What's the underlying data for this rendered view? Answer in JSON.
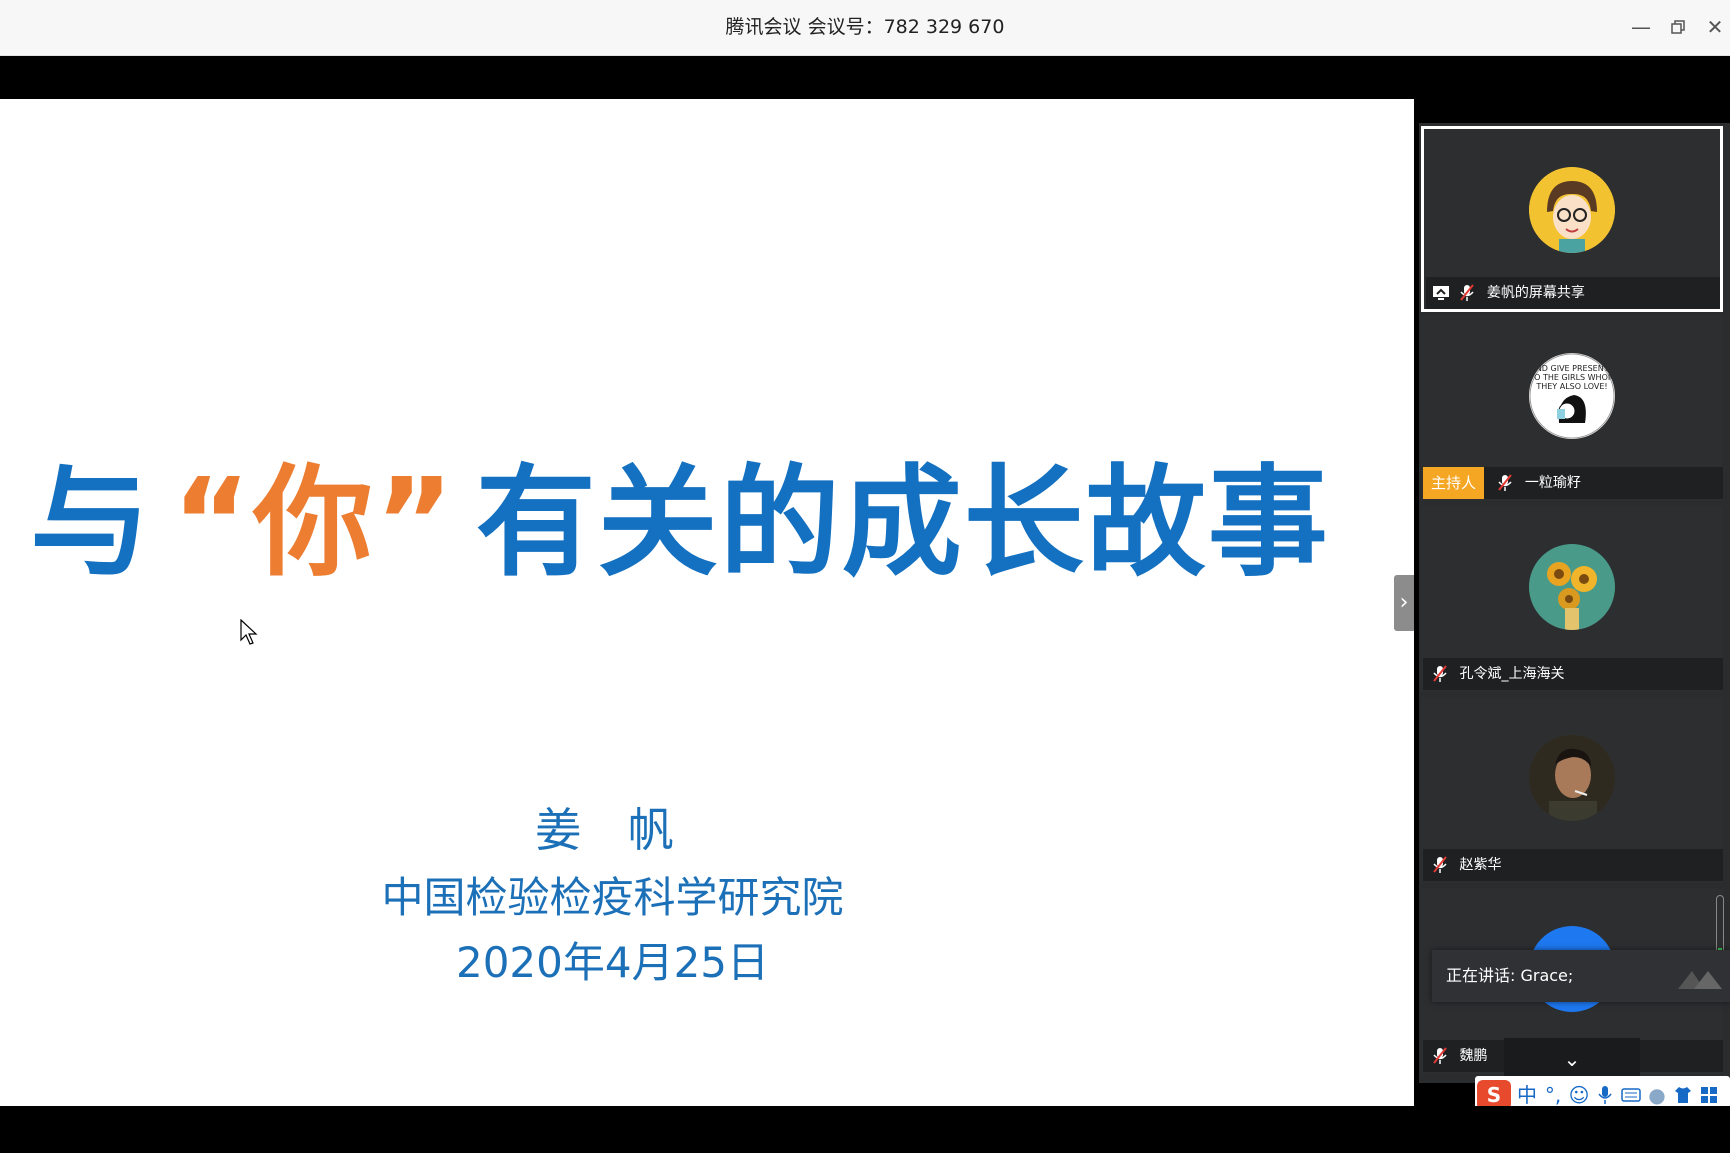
{
  "window": {
    "title": "腾讯会议 会议号：782 329 670",
    "controls": [
      "minimize-icon",
      "restore-icon",
      "close-icon"
    ]
  },
  "slide": {
    "title_part1": "与",
    "title_quote": "“你”",
    "title_part2": "有关的成长故事",
    "author": "姜 帆",
    "organization": "中国检验检疫科学研究院",
    "date": "2020年4月25日",
    "colors": {
      "title_blue": "#1470c0",
      "title_orange": "#ed7d31",
      "body_blue": "#1c70b8"
    }
  },
  "participants": [
    {
      "name": "姜帆的屏幕共享",
      "role": "",
      "sharing": true,
      "avatar": "cartoon-avatar"
    },
    {
      "name": "一粒瑜籽",
      "role": "主持人",
      "sharing": false,
      "avatar": "comic-avatar"
    },
    {
      "name": "孔令斌_上海海关",
      "role": "",
      "sharing": false,
      "avatar": "sunflower-avatar"
    },
    {
      "name": "赵紫华",
      "role": "",
      "sharing": false,
      "avatar": "photo-avatar"
    },
    {
      "name": "魏鹏",
      "role": "",
      "sharing": false,
      "avatar": "blue-avatar"
    }
  ],
  "speaking": {
    "text": "正在讲话: Grace;"
  },
  "ime": {
    "label": "中"
  }
}
